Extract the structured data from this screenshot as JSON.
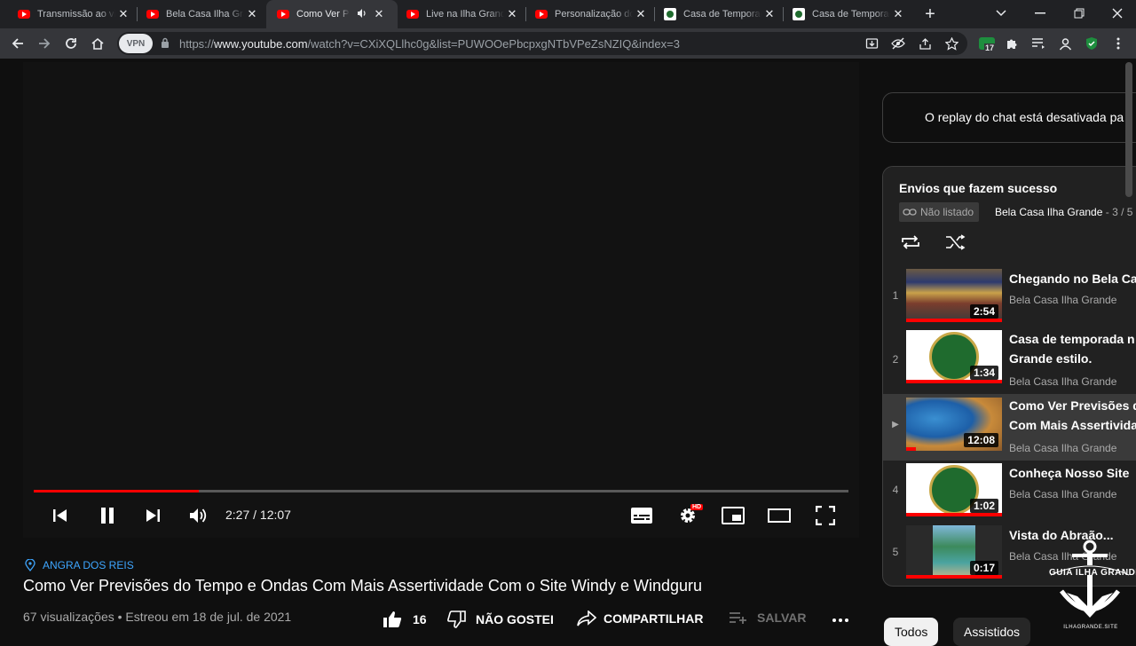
{
  "tabs": [
    {
      "title": "Transmissão ao vivo",
      "favicon": "youtube-icon",
      "active": false
    },
    {
      "title": "Bela Casa Ilha Grande",
      "favicon": "youtube-icon",
      "active": false
    },
    {
      "title": "Como Ver Previsões",
      "favicon": "youtube-icon",
      "active": true,
      "audio": true
    },
    {
      "title": "Live na Ilha Grande",
      "favicon": "youtube-icon",
      "active": false
    },
    {
      "title": "Personalização do canal",
      "favicon": "youtube-icon",
      "active": false
    },
    {
      "title": "Casa de Temporada",
      "favicon": "casa-icon",
      "active": false
    },
    {
      "title": "Casa de Temporada",
      "favicon": "casa-icon",
      "active": false
    }
  ],
  "toolbar": {
    "vpn_label": "VPN",
    "url_host": "https://www.youtube.com",
    "url_scheme": "https://",
    "url_domain": "www.youtube.com",
    "url_path": "/watch?v=CXiXQLlhc0g&list=PUWOOePbcpxgNTbVPeZsNZIQ&index=3",
    "ext_badge": "17"
  },
  "player": {
    "time_current": "2:27",
    "time_separator": " / ",
    "time_total": "12:07",
    "progress": 0.2027,
    "hd_badge": "HD"
  },
  "video": {
    "location": "ANGRA DOS REIS",
    "title": "Como Ver Previsões do Tempo e Ondas Com Mais Assertividade Com o Site Windy e Windguru",
    "views": "67 visualizações",
    "separator": " • ",
    "premiered": "Estreou em 18 de jul. de 2021",
    "likes": "16",
    "dislike_label": "NÃO GOSTEI",
    "share_label": "COMPARTILHAR",
    "save_label": "SALVAR"
  },
  "chat": {
    "replay_text": "O replay do chat está desativada pa"
  },
  "playlist": {
    "title": "Envios que fazem sucesso",
    "badge": "Não listado",
    "channel": "Bela Casa Ilha Grande",
    "position": " - 3 / 5",
    "items": [
      {
        "index": "1",
        "title": "Chegando no Bela Ca",
        "title2": "",
        "channel": "Bela Casa Ilha Grande",
        "duration": "2:54",
        "watched": 1.0
      },
      {
        "index": "2",
        "title": "Casa de temporada n",
        "title2": "Grande estilo.",
        "channel": "Bela Casa Ilha Grande",
        "duration": "1:34",
        "watched": 1.0
      },
      {
        "index": "▶",
        "title": "Como Ver Previsões d",
        "title2": "Com Mais Assertivida",
        "channel": "Bela Casa Ilha Grande",
        "duration": "12:08",
        "watched": 0.1
      },
      {
        "index": "4",
        "title": "Conheça Nosso Site",
        "title2": "",
        "channel": "Bela Casa Ilha Grande",
        "duration": "1:02",
        "watched": 1.0
      },
      {
        "index": "5",
        "title": "Vista do Abraão...",
        "title2": "",
        "channel": "Bela Casa Ilha Grande",
        "duration": "0:17",
        "watched": 1.0
      }
    ]
  },
  "chips": {
    "all": "Todos",
    "watched": "Assistidos"
  },
  "watermark": {
    "text_top": "GUIA ILHA GRANDE",
    "text_bottom": "ILHAGRANDE.SITE"
  },
  "colors": {
    "accent_red": "#ff0000",
    "link_blue": "#3ea6ff",
    "background": "#0f0f0f"
  }
}
